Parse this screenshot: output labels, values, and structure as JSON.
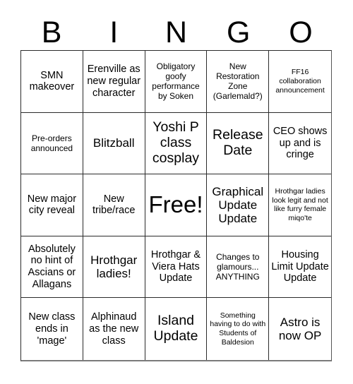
{
  "card": {
    "title_letters": [
      "B",
      "I",
      "N",
      "G",
      "O"
    ],
    "rows": 5,
    "columns": 5,
    "background_color": "#ffffff",
    "text_color": "#000000",
    "border_color": "#2b2b2b",
    "cells": [
      {
        "text": "SMN makeover",
        "size": "md"
      },
      {
        "text": "Erenville as new regular character",
        "size": "md"
      },
      {
        "text": "Obligatory goofy performance by Soken",
        "size": "sm"
      },
      {
        "text": "New Restoration Zone (Garlemald?)",
        "size": "sm"
      },
      {
        "text": "FF16 collaboration announcement",
        "size": "xs"
      },
      {
        "text": "Pre-orders announced",
        "size": "sm"
      },
      {
        "text": "Blitzball",
        "size": "lg"
      },
      {
        "text": "Yoshi P class cosplay",
        "size": "xl"
      },
      {
        "text": "Release Date",
        "size": "xl"
      },
      {
        "text": "CEO shows up and is cringe",
        "size": "md"
      },
      {
        "text": "New major city reveal",
        "size": "md"
      },
      {
        "text": "New tribe/race",
        "size": "md"
      },
      {
        "text": "Free!",
        "size": "free"
      },
      {
        "text": "Graphical Update Update",
        "size": "lg"
      },
      {
        "text": "Hrothgar ladies look legit and not like furry female miqo'te",
        "size": "xs"
      },
      {
        "text": "Absolutely no hint of Ascians or Allagans",
        "size": "md"
      },
      {
        "text": "Hrothgar ladies!",
        "size": "lg"
      },
      {
        "text": "Hrothgar & Viera Hats Update",
        "size": "md"
      },
      {
        "text": "Changes to glamours... ANYTHING",
        "size": "sm"
      },
      {
        "text": "Housing Limit Update Update",
        "size": "md"
      },
      {
        "text": "New class ends in 'mage'",
        "size": "md"
      },
      {
        "text": "Alphinaud as the new class",
        "size": "md"
      },
      {
        "text": "Island Update",
        "size": "xl"
      },
      {
        "text": "Something having to do with Students of Baldesion",
        "size": "xs"
      },
      {
        "text": "Astro is now OP",
        "size": "lg"
      }
    ]
  }
}
